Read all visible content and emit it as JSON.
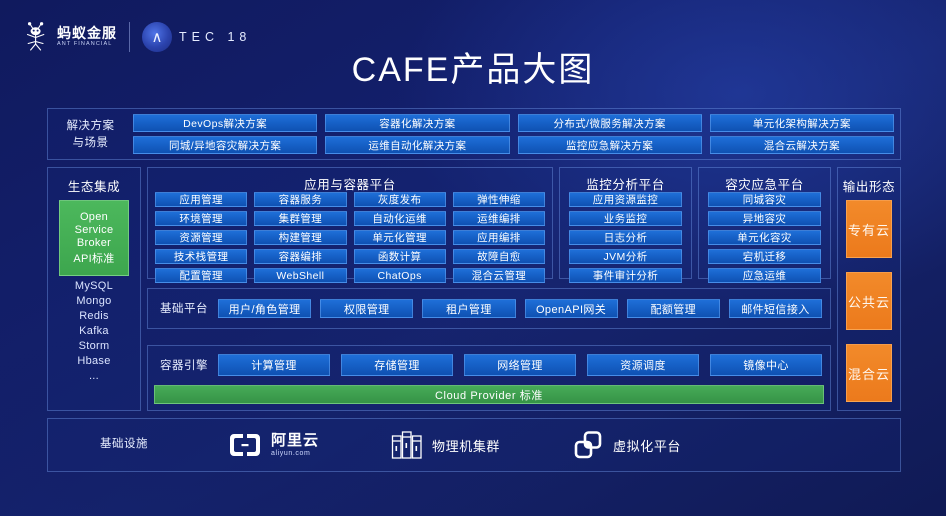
{
  "brand": {
    "ant_cn": "蚂蚁金服",
    "ant_en": "ANT FINANCIAL",
    "atec_mark": "∧",
    "atec_text": "TEC 18"
  },
  "page_title": "CAFE产品大图",
  "solutions": {
    "label": "解决方案\n与场景",
    "label_line1": "解决方案",
    "label_line2": "与场景",
    "row1": [
      "DevOps解决方案",
      "容器化解决方案",
      "分布式/微服务解决方案",
      "单元化架构解决方案"
    ],
    "row2": [
      "同城/异地容灾解决方案",
      "运维自动化解决方案",
      "监控应急解决方案",
      "混合云解决方案"
    ]
  },
  "eco": {
    "title": "生态集成",
    "green_lines": [
      "Open",
      "Service",
      "Broker",
      "API标准"
    ],
    "items": [
      "MySQL",
      "Mongo",
      "Redis",
      "Kafka",
      "Storm",
      "Hbase",
      "..."
    ]
  },
  "app_container": {
    "title": "应用与容器平台",
    "items": [
      "应用管理",
      "容器服务",
      "灰度发布",
      "弹性伸缩",
      "环境管理",
      "集群管理",
      "自动化运维",
      "运维编排",
      "资源管理",
      "构建管理",
      "单元化管理",
      "应用编排",
      "技术栈管理",
      "容器编排",
      "函数计算",
      "故障自愈",
      "配置管理",
      "WebShell",
      "ChatOps",
      "混合云管理"
    ]
  },
  "monitoring": {
    "title": "监控分析平台",
    "items": [
      "应用资源监控",
      "业务监控",
      "日志分析",
      "JVM分析",
      "事件审计分析"
    ]
  },
  "disaster": {
    "title": "容灾应急平台",
    "items": [
      "同城容灾",
      "异地容灾",
      "单元化容灾",
      "宕机迁移",
      "应急运维"
    ]
  },
  "output": {
    "title": "输出形态",
    "items": [
      "专有云",
      "公共云",
      "混合云"
    ]
  },
  "base_platform": {
    "label": "基础平台",
    "items": [
      "用户/角色管理",
      "权限管理",
      "租户管理",
      "OpenAPI网关",
      "配额管理",
      "邮件短信接入"
    ]
  },
  "container_engine": {
    "label": "容器引擎",
    "items": [
      "计算管理",
      "存储管理",
      "网络管理",
      "资源调度",
      "镜像中心"
    ],
    "cloud_provider": "Cloud Provider 标准"
  },
  "infrastructure": {
    "label": "基础设施",
    "items": [
      {
        "name": "阿里云",
        "sub": "aliyun.com",
        "icon": "aliyun-logo-icon"
      },
      {
        "name": "物理机集群",
        "icon": "server-rack-icon"
      },
      {
        "name": "虚拟化平台",
        "icon": "vmware-squares-icon"
      }
    ]
  },
  "colors": {
    "chip_blue": "#1660c6",
    "green": "#3ba34f",
    "orange": "#ef8022",
    "background": "#131f6b"
  }
}
